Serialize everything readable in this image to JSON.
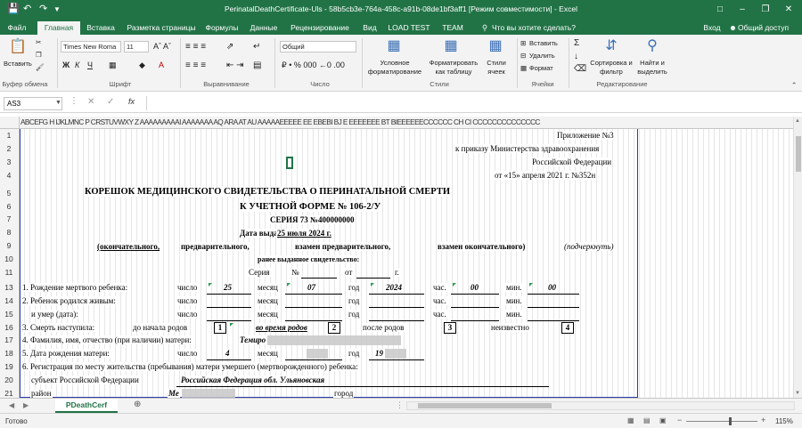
{
  "window": {
    "title": "PerinatalDeathCertificate-Uls - 58b5cb3e-764a-458c-a91b-08de1bf3aff1  [Режим совместимости] - Excel"
  },
  "ribbon_tabs": [
    "Файл",
    "Главная",
    "Вставка",
    "Разметка страницы",
    "Формулы",
    "Данные",
    "Рецензирование",
    "Вид",
    "LOAD TEST",
    "TEAM"
  ],
  "tell_me": "Что вы хотите сделать?",
  "sign_in": "Вход",
  "share": "Общий доступ",
  "ribbon": {
    "paste": "Вставить",
    "clipboard": "Буфер обмена",
    "font_name": "Times New Roma",
    "font_size": "11",
    "font_group": "Шрифт",
    "align_group": "Выравнивание",
    "number_format": "Общий",
    "number_group": "Число",
    "cond_format": "Условное форматирование",
    "format_table": "Форматировать как таблицу",
    "cell_styles": "Стили ячеек",
    "styles_group": "Стили",
    "insert": "Вставить",
    "delete": "Удалить",
    "format": "Формат",
    "cells_group": "Ячейки",
    "sort_filter": "Сортировка и фильтр",
    "find_select": "Найти и выделить",
    "editing_group": "Редактирование"
  },
  "formula_bar": {
    "name_box": "AS3",
    "fx": "fx",
    "value": ""
  },
  "column_header_text": "ABCEFG H IJKLMNC P CRSTUVWXY Z AAAAAAAAAI AAAAAAA AQ ARA AT AU AAAAAEEEEE EE EBEBI BJ E EEEEEEE BT BIEEEEEECCCCCC CH CI CCCCCCCCCCCCCC",
  "row_numbers": [
    "1",
    "2",
    "3",
    "4",
    "5",
    "6",
    "7",
    "8",
    "9",
    "10",
    "11",
    "13",
    "14",
    "15",
    "16",
    "17",
    "18",
    "19",
    "20",
    "21"
  ],
  "document": {
    "appendix": "Приложение №3",
    "order_line": "к приказу Министерства здравоохранения",
    "federation": "Российской Федерации",
    "order_date": "от  «15»  апреля 2021 г.  №352н",
    "title1": "КОРЕШОК МЕДИЦИНСКОГО СВИДЕТЕЛЬСТВА О ПЕРИНАТАЛЬНОЙ СМЕРТИ",
    "title2": "К УЧЕТНОЙ ФОРМЕ № 106-2/У",
    "series": "СЕРИЯ 73  №400000000",
    "issue_label": "Дата выдачи",
    "issue_date": "25 июля 2024 г.",
    "final": "(окончательного,",
    "preliminary": "предварительного,",
    "instead_prelim": "взамен предварительного,",
    "instead_final": "взамен окончательного)",
    "underline_hint": "(подчеркнуть)",
    "earlier": "ранее выданное свидетельство:",
    "series_line": "Серия",
    "number_sign": "№",
    "from": "от",
    "year_g": "г.",
    "r13_label": "1. Рождение мертвого ребенка:",
    "r14_label": "2. Ребенок родился живым:",
    "r15_label": "и умер (дата):",
    "lbl_day": "число",
    "lbl_month": "месяц",
    "lbl_year": "год",
    "lbl_hour": "час.",
    "lbl_min": "мин.",
    "r13_day": "25",
    "r13_month": "07",
    "r13_year": "2024",
    "r13_hour": "00",
    "r13_min": "00",
    "r16_label": "3. Смерть наступила:",
    "before_labor": "до начала родов",
    "box1": "1",
    "during_labor": "во время родов",
    "box2": "2",
    "after_labor": "после родов",
    "box3": "3",
    "unknown": "неизвестно",
    "box4": "4",
    "r17_label": "4. Фамилия, имя, отчество (при наличии) матери:",
    "mother_name": "Темиро",
    "r18_label": "5. Дата рождения матери:",
    "mother_day": "4",
    "mother_year": "19",
    "r19_label": "6. Регистрация по месту жительства (пребывания) матери умершего (мертворожденного) ребенка:",
    "subject_label": "субъект Российской Федерации",
    "subject_value": "Российская Федерация  обл. Ульяновская",
    "district_label": "район",
    "district_value": "Ме",
    "city_label": "город"
  },
  "sheet_tabs": [
    "PDeathCerf"
  ],
  "status": {
    "ready": "Готово",
    "zoom": "115%"
  }
}
